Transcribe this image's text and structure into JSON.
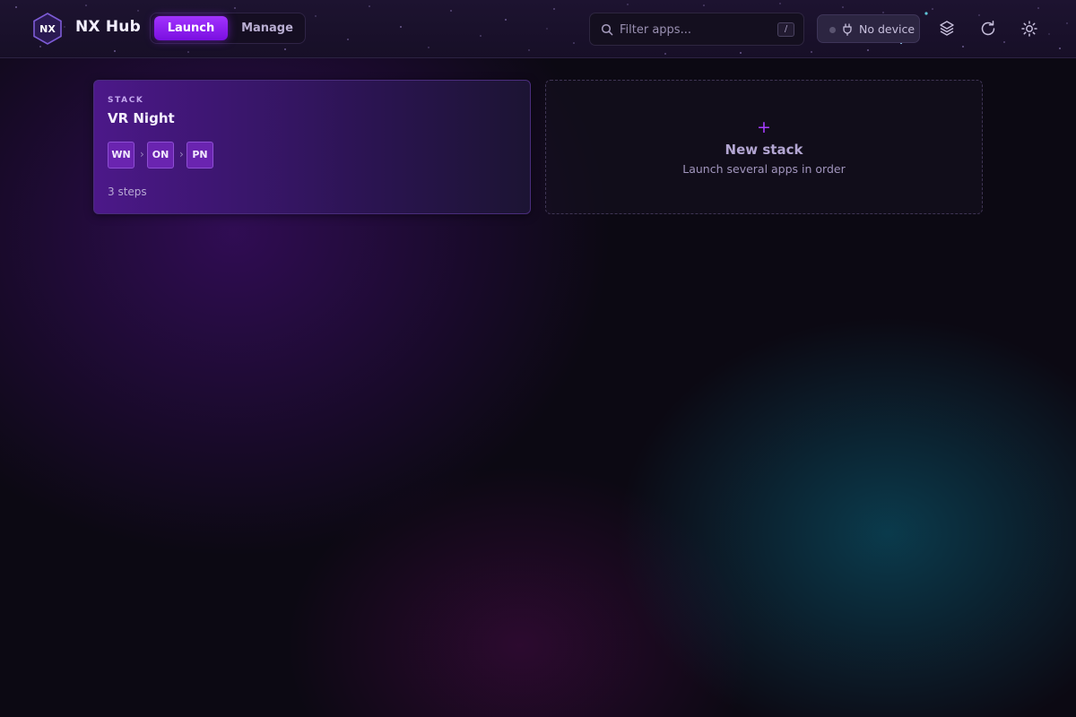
{
  "app": {
    "logo_text": "NX",
    "title": "NX Hub"
  },
  "mode_switch": {
    "active": "Launch",
    "options": [
      "Launch",
      "Manage"
    ]
  },
  "search": {
    "placeholder": "Filter apps...",
    "value": "",
    "shortcut": "/"
  },
  "device": {
    "status_label": "No device",
    "status_color": "#5a5470"
  },
  "toolbar": {
    "icons": [
      "layers-icon",
      "refresh-icon",
      "settings-icon"
    ]
  },
  "stacks": [
    {
      "kicker": "STACK",
      "title": "VR Night",
      "steps": [
        "WN",
        "ON",
        "PN"
      ],
      "step_separator": "›",
      "meta": "3 steps"
    }
  ],
  "new_stack": {
    "icon": "+",
    "title": "New stack",
    "subtitle": "Launch several apps in order"
  },
  "colors": {
    "accent": "#9b2cff",
    "card_gradient_start": "#4c1889",
    "background": "#0c0913"
  }
}
